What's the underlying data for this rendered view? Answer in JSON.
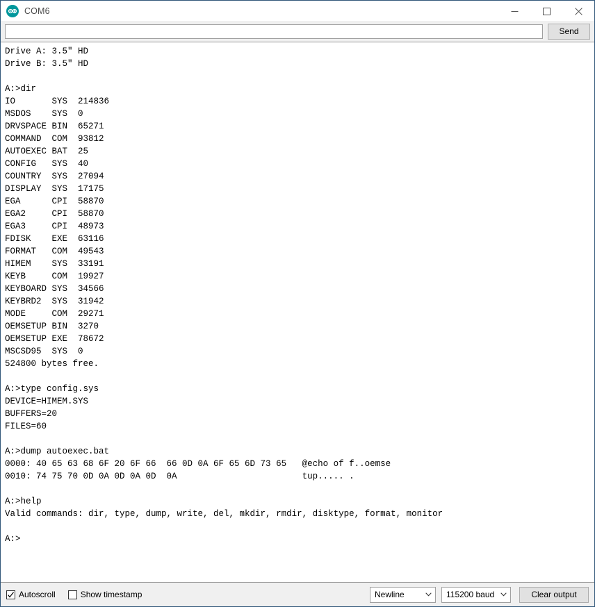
{
  "window": {
    "title": "COM6",
    "icon": "arduino-logo-icon",
    "controls": {
      "minimize": "minimize-icon",
      "maximize": "maximize-icon",
      "close": "close-icon"
    }
  },
  "toolbar": {
    "input_value": "",
    "input_placeholder": "",
    "send_label": "Send"
  },
  "terminal": {
    "lines": [
      "Drive A: 3.5\" HD",
      "Drive B: 3.5\" HD",
      "",
      "A:>dir",
      "IO       SYS  214836",
      "MSDOS    SYS  0",
      "DRVSPACE BIN  65271",
      "COMMAND  COM  93812",
      "AUTOEXEC BAT  25",
      "CONFIG   SYS  40",
      "COUNTRY  SYS  27094",
      "DISPLAY  SYS  17175",
      "EGA      CPI  58870",
      "EGA2     CPI  58870",
      "EGA3     CPI  48973",
      "FDISK    EXE  63116",
      "FORMAT   COM  49543",
      "HIMEM    SYS  33191",
      "KEYB     COM  19927",
      "KEYBOARD SYS  34566",
      "KEYBRD2  SYS  31942",
      "MODE     COM  29271",
      "OEMSETUP BIN  3270",
      "OEMSETUP EXE  78672",
      "MSCSD95  SYS  0",
      "524800 bytes free.",
      "",
      "A:>type config.sys",
      "DEVICE=HIMEM.SYS",
      "BUFFERS=20",
      "FILES=60",
      "",
      "A:>dump autoexec.bat",
      "0000: 40 65 63 68 6F 20 6F 66  66 0D 0A 6F 65 6D 73 65   @echo of f..oemse",
      "0010: 74 75 70 0D 0A 0D 0A 0D  0A                        tup..... .",
      "",
      "A:>help",
      "Valid commands: dir, type, dump, write, del, mkdir, rmdir, disktype, format, monitor",
      "",
      "A:>"
    ]
  },
  "statusbar": {
    "autoscroll": {
      "label": "Autoscroll",
      "checked": true
    },
    "show_timestamp": {
      "label": "Show timestamp",
      "checked": false
    },
    "line_ending": {
      "selected": "Newline"
    },
    "baud_rate": {
      "selected": "115200 baud"
    },
    "clear_label": "Clear output"
  },
  "colors": {
    "window_border": "#31577a",
    "accent": "#00979c",
    "chrome": "#f0f0f0",
    "terminal_bg": "#ffffff",
    "terminal_fg": "#000000"
  }
}
